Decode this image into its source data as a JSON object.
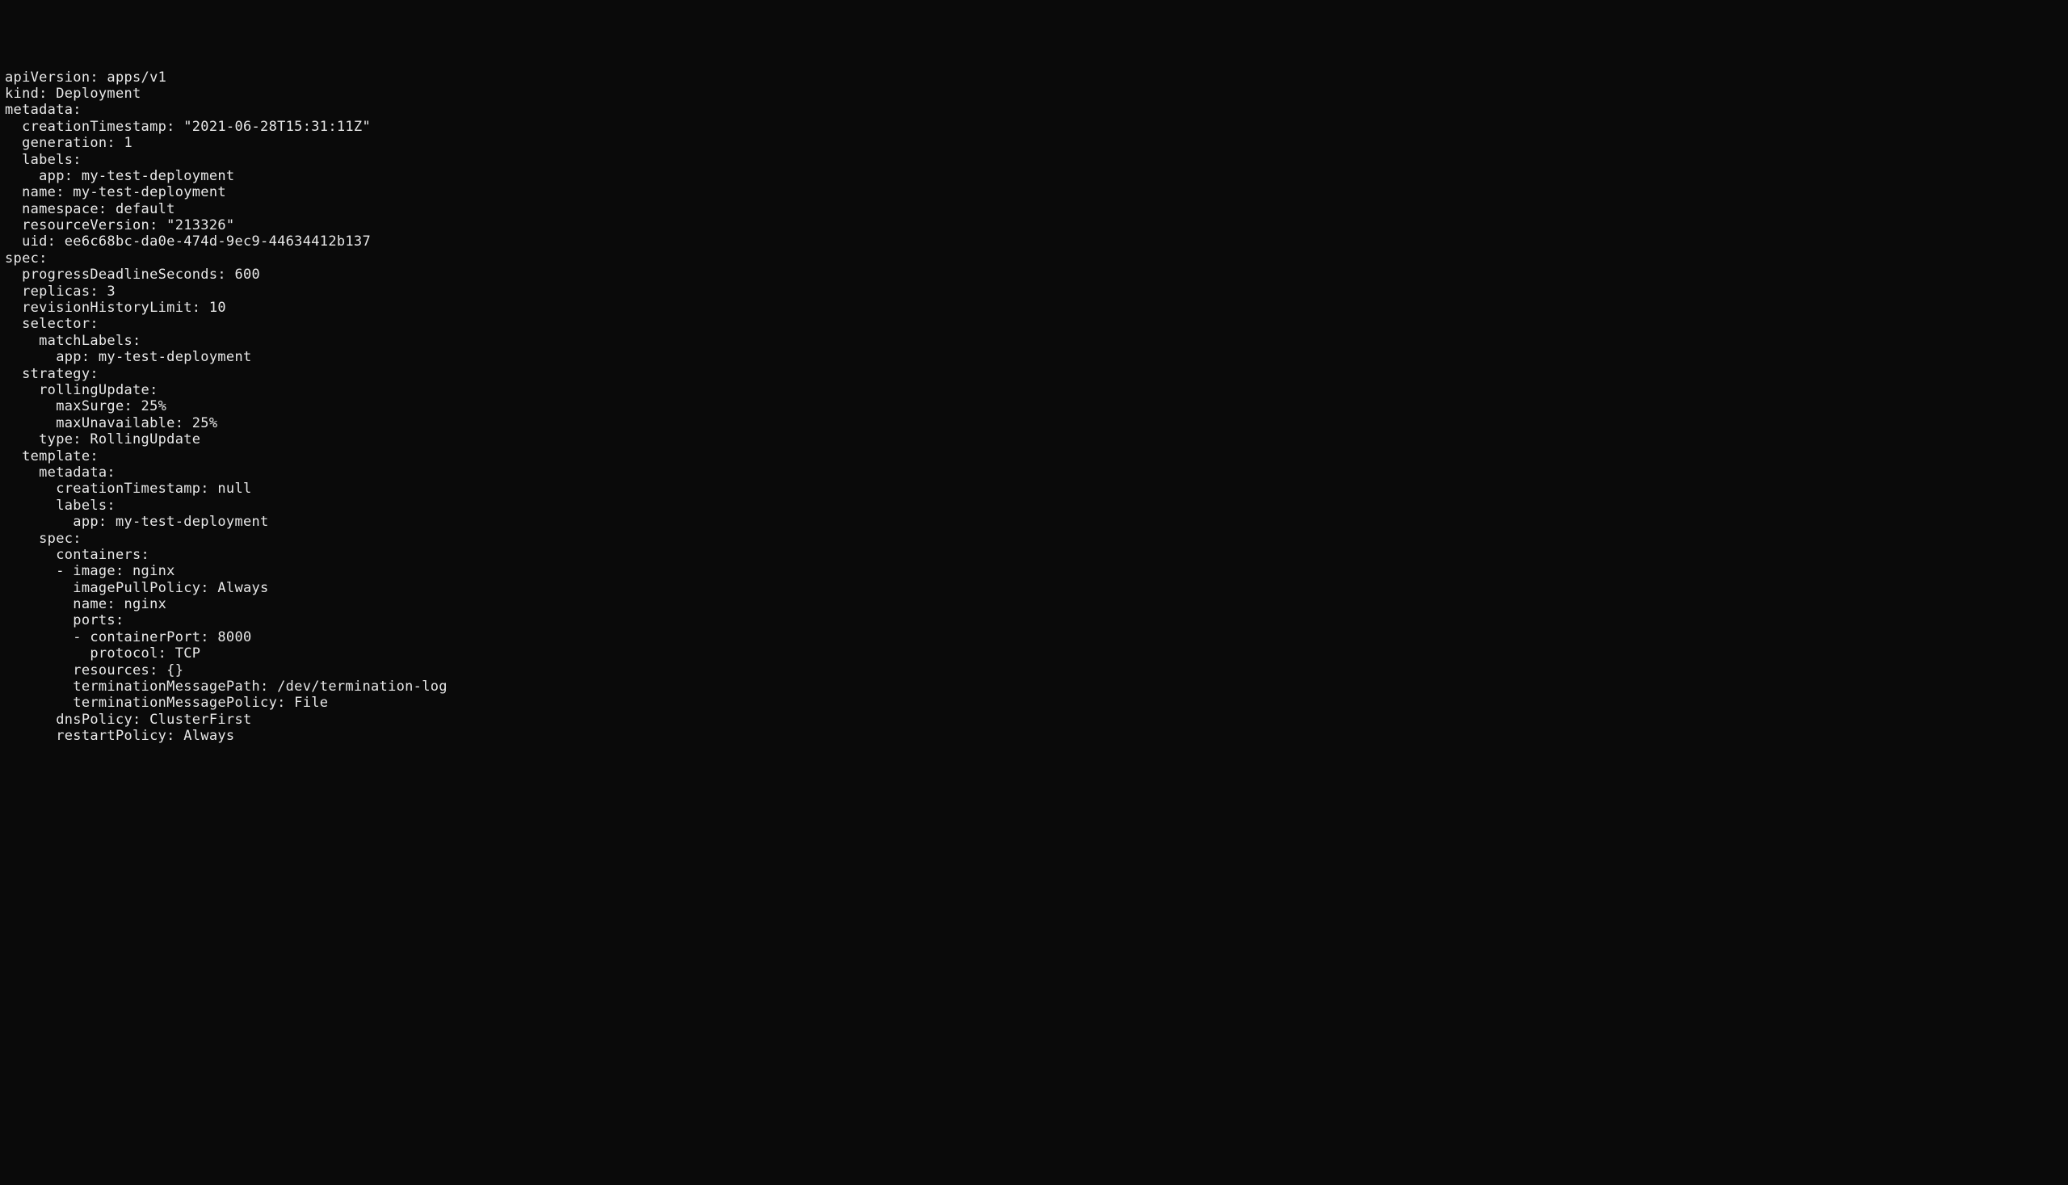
{
  "yaml": {
    "apiVersion": "apps/v1",
    "kind": "Deployment",
    "metadata": {
      "creationTimestamp": "\"2021-06-28T15:31:11Z\"",
      "generation": "1",
      "labels": {
        "app": "my-test-deployment"
      },
      "name": "my-test-deployment",
      "namespace": "default",
      "resourceVersion": "\"213326\"",
      "uid": "ee6c68bc-da0e-474d-9ec9-44634412b137"
    },
    "spec": {
      "progressDeadlineSeconds": "600",
      "replicas": "3",
      "revisionHistoryLimit": "10",
      "selector": {
        "matchLabels": {
          "app": "my-test-deployment"
        }
      },
      "strategy": {
        "rollingUpdate": {
          "maxSurge": "25%",
          "maxUnavailable": "25%"
        },
        "type": "RollingUpdate"
      },
      "template": {
        "metadata": {
          "creationTimestamp": "null",
          "labels": {
            "app": "my-test-deployment"
          }
        },
        "spec": {
          "containers": {
            "image": "nginx",
            "imagePullPolicy": "Always",
            "name": "nginx",
            "ports": {
              "containerPort": "8000",
              "protocol": "TCP"
            },
            "resources": "{}",
            "terminationMessagePath": "/dev/termination-log",
            "terminationMessagePolicy": "File"
          },
          "dnsPolicy": "ClusterFirst",
          "restartPolicy": "Always"
        }
      }
    }
  },
  "lines": {
    "l1": "apiVersion: apps/v1",
    "l2": "kind: Deployment",
    "l3": "metadata:",
    "l4": "  creationTimestamp: \"2021-06-28T15:31:11Z\"",
    "l5": "  generation: 1",
    "l6": "  labels:",
    "l7": "    app: my-test-deployment",
    "l8": "  name: my-test-deployment",
    "l9": "  namespace: default",
    "l10": "  resourceVersion: \"213326\"",
    "l11": "  uid: ee6c68bc-da0e-474d-9ec9-44634412b137",
    "l12": "spec:",
    "l13": "  progressDeadlineSeconds: 600",
    "l14": "  replicas: 3",
    "l15": "  revisionHistoryLimit: 10",
    "l16": "  selector:",
    "l17": "    matchLabels:",
    "l18": "      app: my-test-deployment",
    "l19": "  strategy:",
    "l20": "    rollingUpdate:",
    "l21": "      maxSurge: 25%",
    "l22": "      maxUnavailable: 25%",
    "l23": "    type: RollingUpdate",
    "l24": "  template:",
    "l25": "    metadata:",
    "l26": "      creationTimestamp: null",
    "l27": "      labels:",
    "l28": "        app: my-test-deployment",
    "l29": "    spec:",
    "l30": "      containers:",
    "l31": "      - image: nginx",
    "l32": "        imagePullPolicy: Always",
    "l33": "        name: nginx",
    "l34": "        ports:",
    "l35": "        - containerPort: 8000",
    "l36": "          protocol: TCP",
    "l37": "        resources: {}",
    "l38": "        terminationMessagePath: /dev/termination-log",
    "l39": "        terminationMessagePolicy: File",
    "l40": "      dnsPolicy: ClusterFirst",
    "l41": "      restartPolicy: Always"
  }
}
